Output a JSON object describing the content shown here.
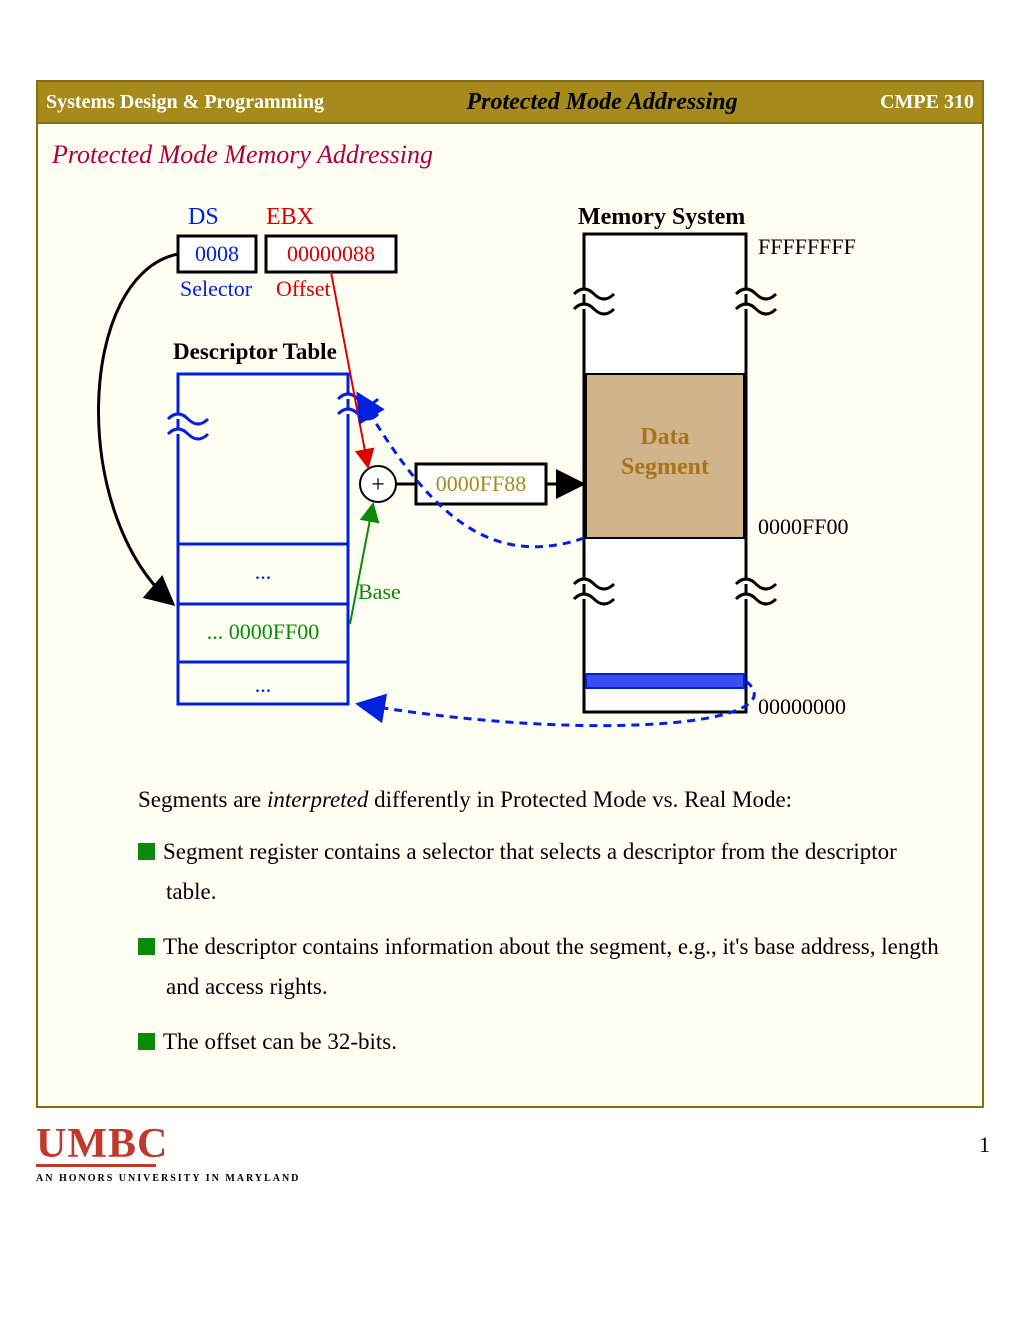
{
  "header": {
    "left": "Systems Design & Programming",
    "center": "Protected Mode Addressing",
    "right": "CMPE 310"
  },
  "subtitle": "Protected Mode Memory Addressing",
  "diagram": {
    "ds_label": "DS",
    "ds_value": "0008",
    "ds_caption": "Selector",
    "ebx_label": "EBX",
    "ebx_value": "00000088",
    "ebx_caption": "Offset",
    "desc_table_title": "Descriptor Table",
    "desc_row_ell1": "...",
    "desc_row_val": "... 0000FF00",
    "desc_row_ell2": "...",
    "base_label": "Base",
    "plus": "+",
    "sum_value": "0000FF88",
    "mem_title": "Memory System",
    "mem_top": "FFFFFFFF",
    "mem_mid": "0000FF00",
    "mem_bot": "00000000",
    "data_l1": "Data",
    "data_l2": "Segment"
  },
  "body": {
    "intro_a": "Segments are ",
    "intro_i": "interpreted",
    "intro_b": " differently in Protected Mode vs. Real Mode:",
    "b1_a": "Segment register contains a ",
    "b1_i1": "selector",
    "b1_b": " that selects a ",
    "b1_i2": "descriptor",
    "b1_c": " from the descriptor",
    "b1_d": "table.",
    "b2_a": "The ",
    "b2_i": "descriptor",
    "b2_b": " contains information about the segment, e.g., it's base address, length",
    "b2_c": "and access rights.",
    "b3": "The offset can be 32-bits."
  },
  "footer": {
    "logo": "UMBC",
    "tagline": "AN HONORS UNIVERSITY IN MARYLAND",
    "page": "1"
  }
}
